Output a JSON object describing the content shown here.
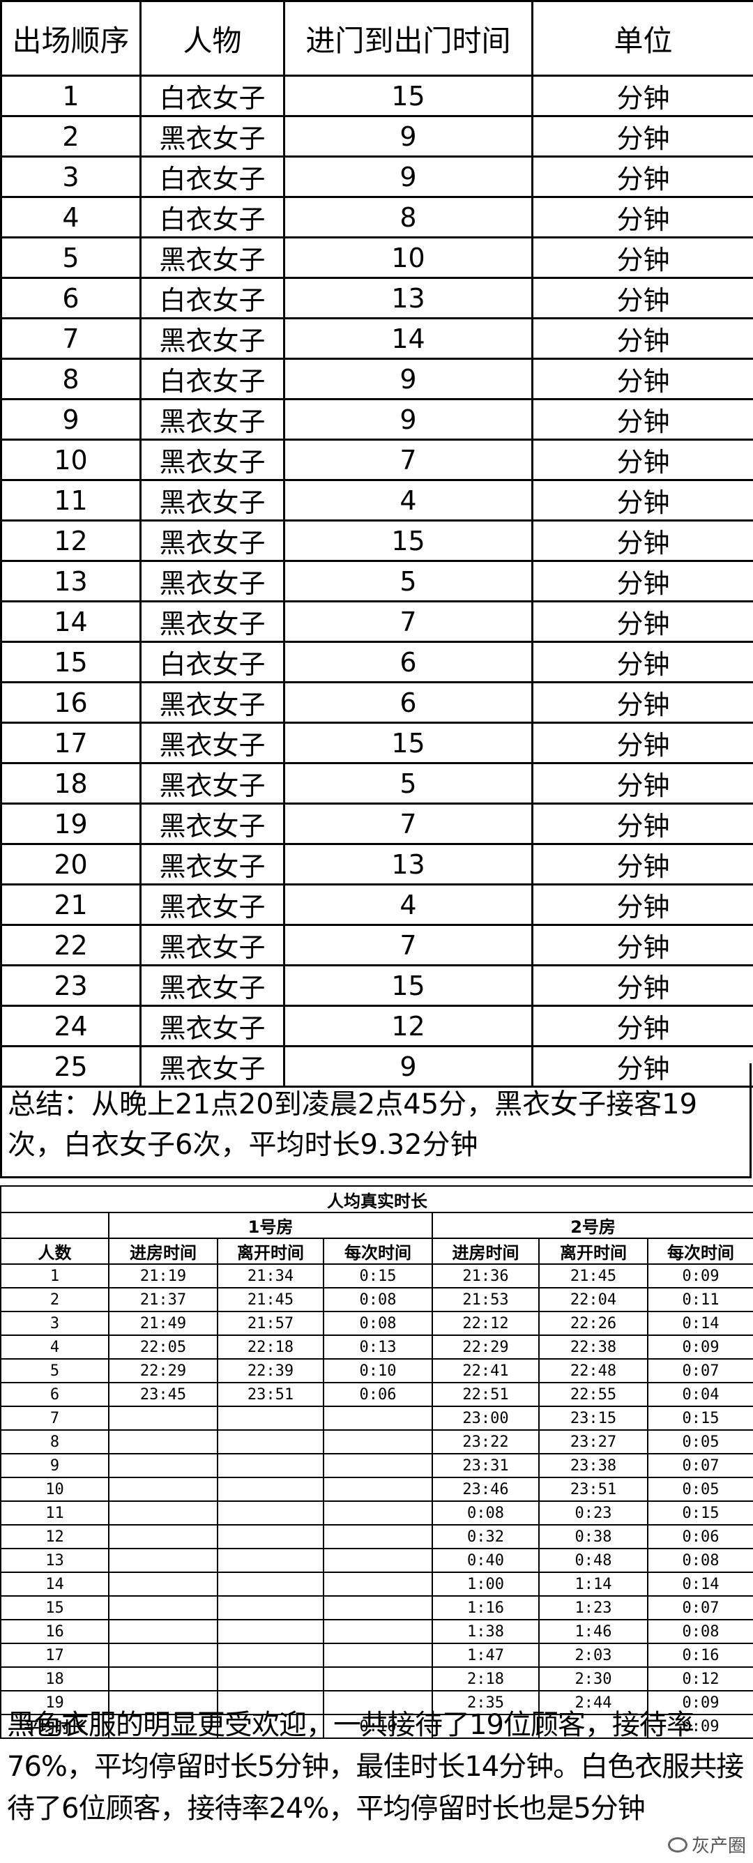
{
  "table1": {
    "headers": [
      "出场顺序",
      "人物",
      "进门到出门时间",
      "单位"
    ],
    "rows": [
      [
        "1",
        "白衣女子",
        "15",
        "分钟"
      ],
      [
        "2",
        "黑衣女子",
        "9",
        "分钟"
      ],
      [
        "3",
        "白衣女子",
        "9",
        "分钟"
      ],
      [
        "4",
        "白衣女子",
        "8",
        "分钟"
      ],
      [
        "5",
        "黑衣女子",
        "10",
        "分钟"
      ],
      [
        "6",
        "白衣女子",
        "13",
        "分钟"
      ],
      [
        "7",
        "黑衣女子",
        "14",
        "分钟"
      ],
      [
        "8",
        "白衣女子",
        "9",
        "分钟"
      ],
      [
        "9",
        "黑衣女子",
        "9",
        "分钟"
      ],
      [
        "10",
        "黑衣女子",
        "7",
        "分钟"
      ],
      [
        "11",
        "黑衣女子",
        "4",
        "分钟"
      ],
      [
        "12",
        "黑衣女子",
        "15",
        "分钟"
      ],
      [
        "13",
        "黑衣女子",
        "5",
        "分钟"
      ],
      [
        "14",
        "黑衣女子",
        "7",
        "分钟"
      ],
      [
        "15",
        "白衣女子",
        "6",
        "分钟"
      ],
      [
        "16",
        "黑衣女子",
        "6",
        "分钟"
      ],
      [
        "17",
        "黑衣女子",
        "15",
        "分钟"
      ],
      [
        "18",
        "黑衣女子",
        "5",
        "分钟"
      ],
      [
        "19",
        "黑衣女子",
        "7",
        "分钟"
      ],
      [
        "20",
        "黑衣女子",
        "13",
        "分钟"
      ],
      [
        "21",
        "黑衣女子",
        "4",
        "分钟"
      ],
      [
        "22",
        "黑衣女子",
        "7",
        "分钟"
      ],
      [
        "23",
        "黑衣女子",
        "15",
        "分钟"
      ],
      [
        "24",
        "黑衣女子",
        "12",
        "分钟"
      ],
      [
        "25",
        "黑衣女子",
        "9",
        "分钟"
      ]
    ],
    "summary": "总结：从晚上21点20到凌晨2点45分，黑衣女子接客19次，白衣女子6次，平均时长9.32分钟"
  },
  "table2": {
    "title": "人均真实时长",
    "room1": "1号房",
    "room2": "2号房",
    "col_count": "人数",
    "col_in": "进房时间",
    "col_out": "离开时间",
    "col_each": "每次时间",
    "rows": [
      [
        "1",
        "21:19",
        "21:34",
        "0:15",
        "21:36",
        "21:45",
        "0:09"
      ],
      [
        "2",
        "21:37",
        "21:45",
        "0:08",
        "21:53",
        "22:04",
        "0:11"
      ],
      [
        "3",
        "21:49",
        "21:57",
        "0:08",
        "22:12",
        "22:26",
        "0:14"
      ],
      [
        "4",
        "22:05",
        "22:18",
        "0:13",
        "22:29",
        "22:38",
        "0:09"
      ],
      [
        "5",
        "22:29",
        "22:39",
        "0:10",
        "22:41",
        "22:48",
        "0:07"
      ],
      [
        "6",
        "23:45",
        "23:51",
        "0:06",
        "22:51",
        "22:55",
        "0:04"
      ],
      [
        "7",
        "",
        "",
        "",
        "23:00",
        "23:15",
        "0:15"
      ],
      [
        "8",
        "",
        "",
        "",
        "23:22",
        "23:27",
        "0:05"
      ],
      [
        "9",
        "",
        "",
        "",
        "23:31",
        "23:38",
        "0:07"
      ],
      [
        "10",
        "",
        "",
        "",
        "23:46",
        "23:51",
        "0:05"
      ],
      [
        "11",
        "",
        "",
        "",
        "0:08",
        "0:23",
        "0:15"
      ],
      [
        "12",
        "",
        "",
        "",
        "0:32",
        "0:38",
        "0:06"
      ],
      [
        "13",
        "",
        "",
        "",
        "0:40",
        "0:48",
        "0:08"
      ],
      [
        "14",
        "",
        "",
        "",
        "1:00",
        "1:14",
        "0:14"
      ],
      [
        "15",
        "",
        "",
        "",
        "1:16",
        "1:23",
        "0:07"
      ],
      [
        "16",
        "",
        "",
        "",
        "1:38",
        "1:46",
        "0:08"
      ],
      [
        "17",
        "",
        "",
        "",
        "1:47",
        "2:03",
        "0:16"
      ],
      [
        "18",
        "",
        "",
        "",
        "2:18",
        "2:30",
        "0:12"
      ],
      [
        "19",
        "",
        "",
        "",
        "2:35",
        "2:44",
        "0:09"
      ]
    ],
    "avg_label": "平均时长",
    "avg_room1": "0:10",
    "avg_room2": "0:09"
  },
  "summary2": "黑色衣服的明显更受欢迎，一共接待了19位顾客，接待率76%，平均停留时长5分钟，最佳时长14分钟。白色衣服共接待了6位顾客，接待率24%，平均停留时长也是5分钟",
  "watermark": "灰产圈"
}
